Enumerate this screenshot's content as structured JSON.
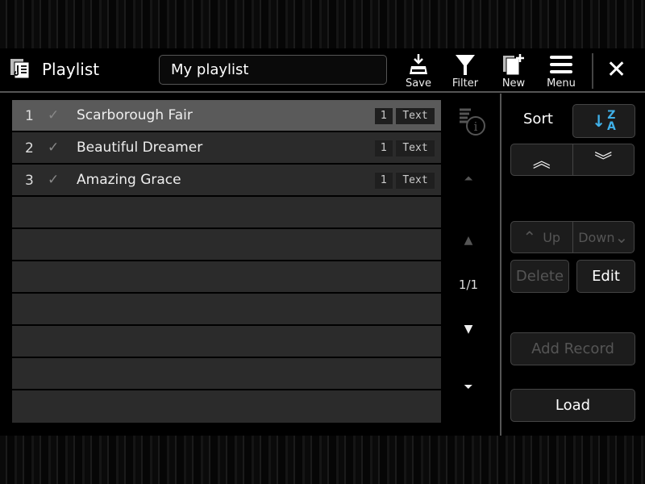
{
  "header": {
    "title": "Playlist",
    "playlist_name": "My playlist",
    "save": "Save",
    "filter": "Filter",
    "new": "New",
    "menu": "Menu",
    "close": "✕"
  },
  "list": {
    "rows": [
      {
        "num": "1",
        "check": "✓",
        "name": "Scarborough Fair",
        "count": "1",
        "type": "Text",
        "selected": true
      },
      {
        "num": "2",
        "check": "✓",
        "name": "Beautiful Dreamer",
        "count": "1",
        "type": "Text"
      },
      {
        "num": "3",
        "check": "✓",
        "name": "Amazing Grace",
        "count": "1",
        "type": "Text"
      }
    ]
  },
  "scroll": {
    "page": "1/1",
    "top": "⏶",
    "up": "▲",
    "down": "▼",
    "bottom": "⏷"
  },
  "panel": {
    "sort": "Sort",
    "sort_icon_z": "Z",
    "sort_icon_a": "A",
    "move_top": "︽",
    "move_bottom": "︾",
    "up": "Up",
    "down": "Down",
    "up_arrow": "⌃",
    "down_arrow": "⌄",
    "delete": "Delete",
    "edit": "Edit",
    "add_record": "Add Record",
    "load": "Load"
  },
  "colors": {
    "accent": "#3fb0e8",
    "selected_row": "#5a5a5a",
    "row": "#2b2b2b"
  }
}
